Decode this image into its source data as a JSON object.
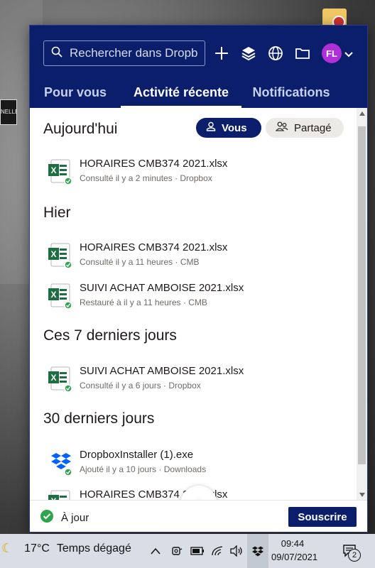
{
  "search": {
    "placeholder": "Rechercher dans Dropbox"
  },
  "header": {
    "avatar_initials": "FL",
    "brand_color": "#0a1e6b",
    "avatar_color": "#b12fd6"
  },
  "tabs": [
    {
      "label": "Pour vous",
      "active": false
    },
    {
      "label": "Activité récente",
      "active": true
    },
    {
      "label": "Notifications",
      "active": false
    }
  ],
  "filters": {
    "you_label": "Vous",
    "shared_label": "Partagé"
  },
  "sections": [
    {
      "title": "Aujourd'hui",
      "items": [
        {
          "name": "HORAIRES CMB374 2021.xlsx",
          "meta": "Consulté il y a 2 minutes · Dropbox",
          "icon": "excel-icon"
        }
      ]
    },
    {
      "title": "Hier",
      "items": [
        {
          "name": "HORAIRES CMB374 2021.xlsx",
          "meta": "Consulté il y a 11 heures · CMB",
          "icon": "excel-icon"
        },
        {
          "name": "SUIVI ACHAT AMBOISE 2021.xlsx",
          "meta": "Restauré à il y a 11 heures · CMB",
          "icon": "excel-icon"
        }
      ]
    },
    {
      "title": "Ces 7 derniers jours",
      "items": [
        {
          "name": "SUIVI ACHAT AMBOISE 2021.xlsx",
          "meta": "Consulté il y a 6 jours · Dropbox",
          "icon": "excel-icon"
        }
      ]
    },
    {
      "title": "30 derniers jours",
      "items": [
        {
          "name": "DropboxInstaller (1).exe",
          "meta": "Ajouté il y a 10 jours · Downloads",
          "icon": "dropbox-icon"
        },
        {
          "name": "HORAIRES CMB374 2021.xlsx",
          "meta": "",
          "icon": "excel-icon"
        }
      ]
    }
  ],
  "footer": {
    "status_label": "À jour",
    "subscribe_label": "Souscrire"
  },
  "taskbar": {
    "temperature": "17°C",
    "weather": "Temps dégagé",
    "time": "09:44",
    "date": "09/07/2021",
    "notification_count": "2"
  }
}
